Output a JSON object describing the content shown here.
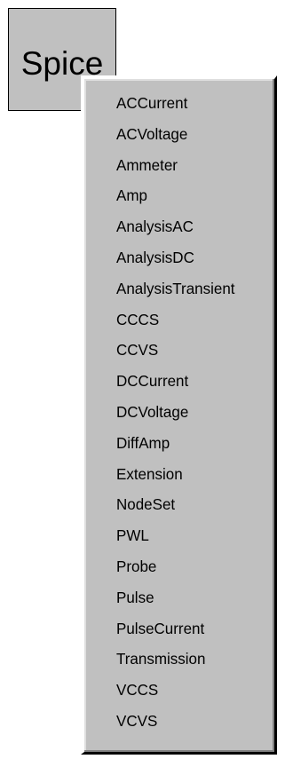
{
  "palette": {
    "button_label": "Spice"
  },
  "menu": {
    "items": [
      {
        "label": "ACCurrent"
      },
      {
        "label": "ACVoltage"
      },
      {
        "label": "Ammeter"
      },
      {
        "label": "Amp"
      },
      {
        "label": "AnalysisAC"
      },
      {
        "label": "AnalysisDC"
      },
      {
        "label": "AnalysisTransient"
      },
      {
        "label": "CCCS"
      },
      {
        "label": "CCVS"
      },
      {
        "label": "DCCurrent"
      },
      {
        "label": "DCVoltage"
      },
      {
        "label": "DiffAmp"
      },
      {
        "label": "Extension"
      },
      {
        "label": "NodeSet"
      },
      {
        "label": "PWL"
      },
      {
        "label": "Probe"
      },
      {
        "label": "Pulse"
      },
      {
        "label": "PulseCurrent"
      },
      {
        "label": "Transmission"
      },
      {
        "label": "VCCS"
      },
      {
        "label": "VCVS"
      }
    ]
  },
  "colors": {
    "face": "#c0c0c0",
    "highlight": "#ffffff",
    "shadow": "#808080",
    "dark": "#000000"
  }
}
